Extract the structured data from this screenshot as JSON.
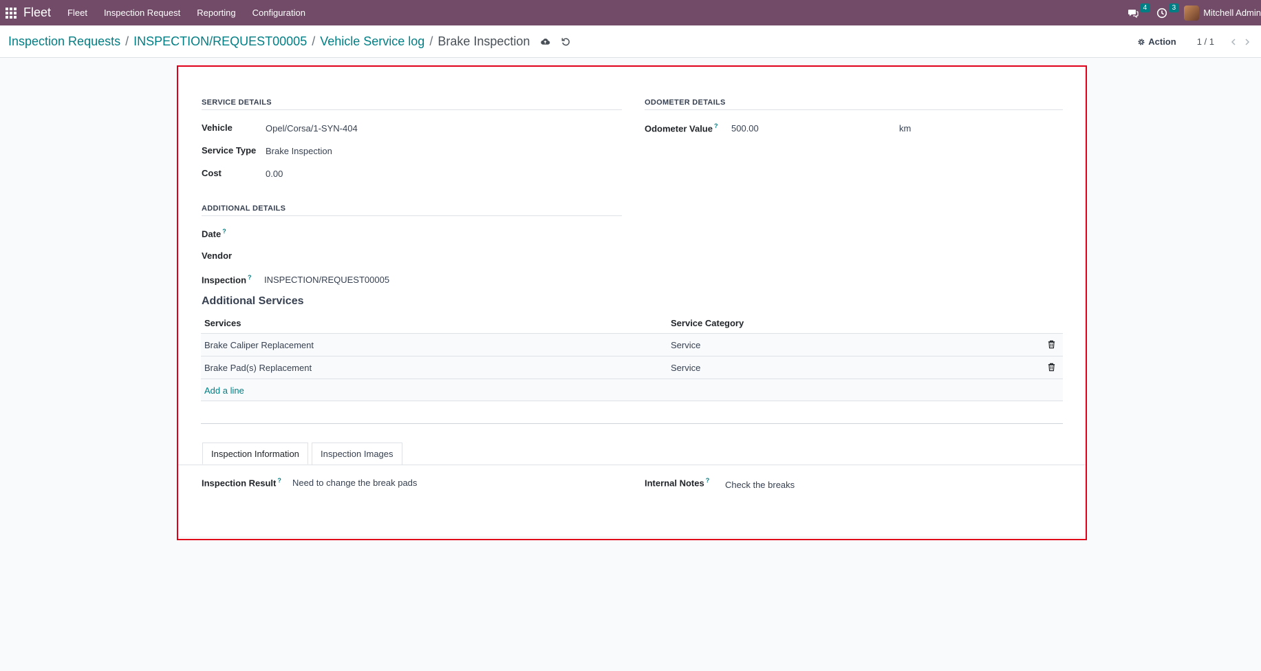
{
  "navbar": {
    "brand": "Fleet",
    "menu": [
      "Fleet",
      "Inspection Request",
      "Reporting",
      "Configuration"
    ],
    "messages_count": "4",
    "activities_count": "3",
    "user_name": "Mitchell Admin"
  },
  "breadcrumb": {
    "items": [
      "Inspection Requests",
      "INSPECTION/REQUEST00005",
      "Vehicle Service log"
    ],
    "current": "Brake Inspection"
  },
  "control": {
    "action_label": "Action",
    "pager": "1 / 1"
  },
  "service_details": {
    "title": "SERVICE DETAILS",
    "vehicle_label": "Vehicle",
    "vehicle_value": "Opel/Corsa/1-SYN-404",
    "service_type_label": "Service Type",
    "service_type_value": "Brake Inspection",
    "cost_label": "Cost",
    "cost_value": "0.00"
  },
  "odometer_details": {
    "title": "ODOMETER DETAILS",
    "odometer_label": "Odometer Value",
    "odometer_value": "500.00",
    "odometer_unit": "km"
  },
  "additional_details": {
    "title": "ADDITIONAL DETAILS",
    "date_label": "Date",
    "vendor_label": "Vendor",
    "inspection_label": "Inspection",
    "inspection_value": "INSPECTION/REQUEST00005"
  },
  "additional_services": {
    "title": "Additional Services",
    "col_services": "Services",
    "col_category": "Service Category",
    "rows": [
      {
        "service": "Brake Caliper Replacement",
        "category": "Service"
      },
      {
        "service": "Brake Pad(s) Replacement",
        "category": "Service"
      }
    ],
    "add_line": "Add a line"
  },
  "tabs": {
    "items": [
      "Inspection Information",
      "Inspection Images"
    ],
    "active_index": 0
  },
  "inspection_info": {
    "result_label": "Inspection Result",
    "result_value": "Need to change the break pads",
    "notes_label": "Internal Notes",
    "notes_value": "Check the breaks"
  },
  "help_marker": "?",
  "colors": {
    "navbar": "#714b67",
    "link": "#017e84",
    "highlight_border": "#e0001a"
  }
}
